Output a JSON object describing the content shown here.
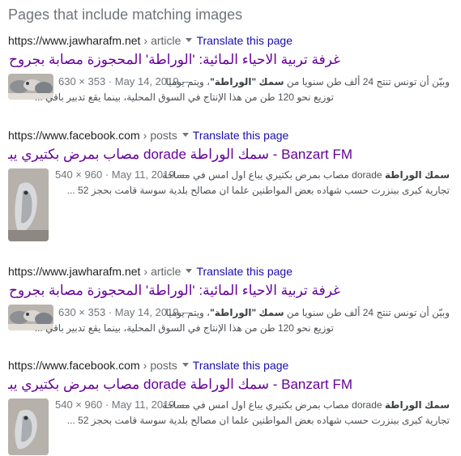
{
  "section": {
    "title": "Pages that include matching images"
  },
  "results": [
    {
      "url": "https://www.jawharafm.net",
      "path": "article",
      "translate": "Translate this page",
      "title": "غرفة تربية الاحياء المائية: 'الوراطة' المحجوزة مصابة بجروح وليس ...",
      "dims": "630 × 353",
      "date": "May 14, 2019",
      "dash": "—",
      "snippet_line1_pre": "وبيّن أن تونس تنتج 24 ألف طن سنويا من ",
      "snippet_line1_bold": "سمك \"الوراطة\"",
      "snippet_line1_post": "، ويتم يوميا",
      "snippet_line2": "توزيع نحو 120 طن من هذا الإنتاج في السوق المحلية، بينما يقع تدبير باقي ..."
    },
    {
      "url": "https://www.facebook.com",
      "path": "posts",
      "translate": "Translate this page",
      "title": "Banzart FM - سمك الوراطة dorade مصاب بمرض بكتيري يباع...",
      "dims": "540 × 960",
      "date": "May 11, 2019",
      "dash": "—",
      "snippet_line1_bold": "سمك الوراطة",
      "snippet_line1_post": " dorade مصاب بمرض بكتيري يباع اول امس في مساحة",
      "snippet_line2": "تجارية كبرى ببنزرت حسب شهاده بعض المواطنين علما ان مصالح بلدية سوسة قامت بحجز 52 ..."
    },
    {
      "url": "https://www.jawharafm.net",
      "path": "article",
      "translate": "Translate this page",
      "title": "غرفة تربية الاحياء المائية: 'الوراطة' المحجوزة مصابة بجروح وليس ...",
      "dims": "630 × 353",
      "date": "May 14, 2019",
      "dash": "—",
      "snippet_line1_pre": "وبيّن أن تونس تنتج 24 ألف طن سنويا من ",
      "snippet_line1_bold": "سمك \"الوراطة\"",
      "snippet_line1_post": "، ويتم يوميا",
      "snippet_line2": "توزيع نحو 120 طن من هذا الإنتاج في السوق المحلية، بينما يقع تدبير باقي ..."
    },
    {
      "url": "https://www.facebook.com",
      "path": "posts",
      "translate": "Translate this page",
      "title": "Banzart FM - سمك الوراطة dorade مصاب بمرض بكتيري يباع...",
      "dims": "540 × 960",
      "date": "May 11, 2019",
      "dash": "—",
      "snippet_line1_bold": "سمك الوراطة",
      "snippet_line1_post": " dorade مصاب بمرض بكتيري يباع اول امس في مساحة",
      "snippet_line2": "تجارية كبرى ببنزرت حسب شهاده بعض المواطنين علما ان مصالح بلدية سوسة قامت بحجز 52 ..."
    }
  ],
  "separators": {
    "breadcrumb": "›",
    "meta_dot": "·"
  },
  "colors": {
    "link_visited": "#660099",
    "link_blue": "#1a0dab",
    "meta_gray": "#70757a"
  }
}
